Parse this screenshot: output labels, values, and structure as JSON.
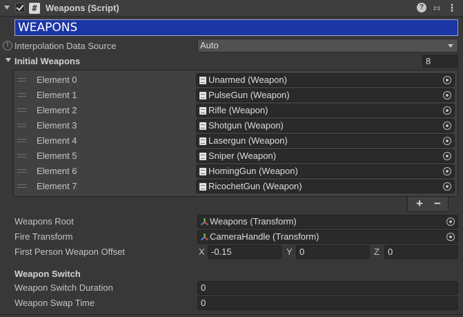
{
  "header": {
    "title": "Weapons (Script)",
    "script_icon": "#",
    "help_icon": "?",
    "presets_icon": "⧦",
    "menu_icon": "⋮"
  },
  "banner": {
    "text": "WEAPONS",
    "color": "#1c35a5"
  },
  "interpolation": {
    "label": "Interpolation Data Source",
    "value": "Auto"
  },
  "initial_weapons": {
    "label": "Initial Weapons",
    "size": "8",
    "elements": [
      {
        "label": "Element 0",
        "value": "Unarmed (Weapon)"
      },
      {
        "label": "Element 1",
        "value": "PulseGun (Weapon)"
      },
      {
        "label": "Element 2",
        "value": "Rifle (Weapon)"
      },
      {
        "label": "Element 3",
        "value": "Shotgun (Weapon)"
      },
      {
        "label": "Element 4",
        "value": "Lasergun (Weapon)"
      },
      {
        "label": "Element 5",
        "value": "Sniper (Weapon)"
      },
      {
        "label": "Element 6",
        "value": "HomingGun (Weapon)"
      },
      {
        "label": "Element 7",
        "value": "RicochetGun (Weapon)"
      }
    ],
    "add_label": "+",
    "remove_label": "−"
  },
  "weapons_root": {
    "label": "Weapons Root",
    "value": "Weapons (Transform)"
  },
  "fire_transform": {
    "label": "Fire Transform",
    "value": "CameraHandle (Transform)"
  },
  "offset": {
    "label": "First Person Weapon Offset",
    "x_label": "X",
    "x": "-0.15",
    "y_label": "Y",
    "y": "0",
    "z_label": "Z",
    "z": "0"
  },
  "weapon_switch": {
    "heading": "Weapon Switch",
    "duration_label": "Weapon Switch Duration",
    "duration": "0",
    "swap_label": "Weapon Swap Time",
    "swap": "0"
  }
}
